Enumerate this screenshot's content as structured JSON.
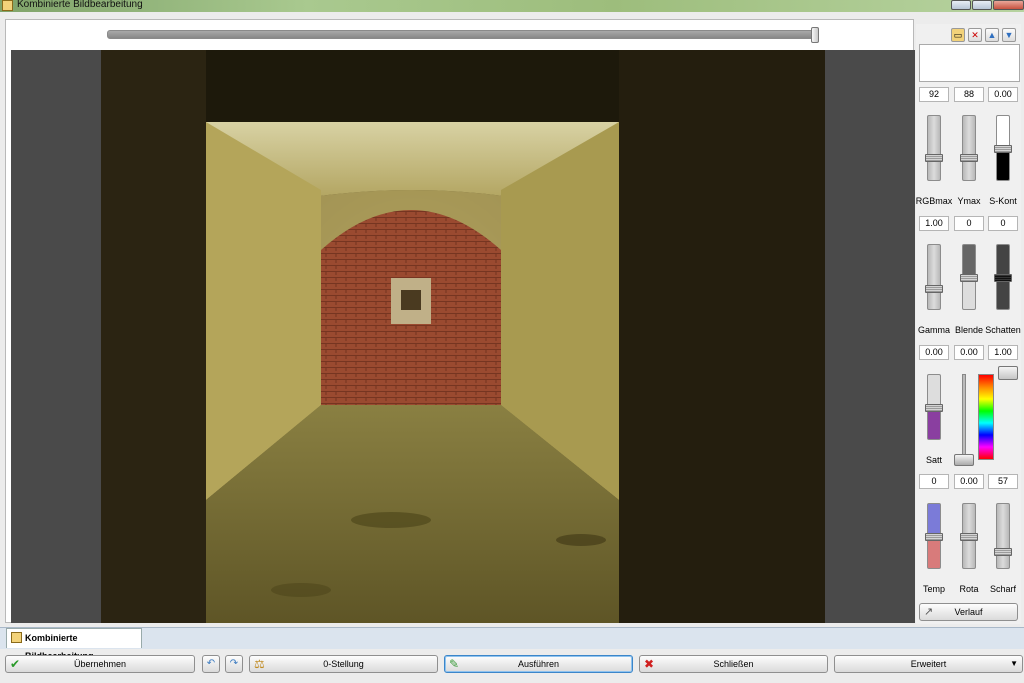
{
  "window": {
    "title": "Kombinierte Bildbearbeitung"
  },
  "top_icons": [
    "folder-icon",
    "delete-icon",
    "move-up-icon",
    "move-down-icon"
  ],
  "row1": {
    "values": [
      "92",
      "88",
      "0.00"
    ],
    "labels": [
      "RGBmax",
      "Ymax",
      "S-Kont"
    ]
  },
  "row2": {
    "values": [
      "1.00",
      "0",
      "0"
    ],
    "labels": [
      "Gamma",
      "Blende",
      "Schatten"
    ]
  },
  "row3": {
    "values": [
      "0.00",
      "0.00",
      "1.00"
    ],
    "labels": [
      "Satt"
    ]
  },
  "row4": {
    "values": [
      "0",
      "0.00",
      "57"
    ],
    "labels": [
      "Temp",
      "Rota",
      "Scharf"
    ]
  },
  "verlauf_label": "Verlauf",
  "tab": {
    "label": "Kombinierte Bildbearbeitung"
  },
  "buttons": {
    "uebernehmen": "Übernehmen",
    "null_stellung": "0-Stellung",
    "ausfuehren": "Ausführen",
    "schliessen": "Schließen",
    "erweitert": "Erweitert"
  },
  "colors": {
    "accent": "#3c86c9"
  }
}
